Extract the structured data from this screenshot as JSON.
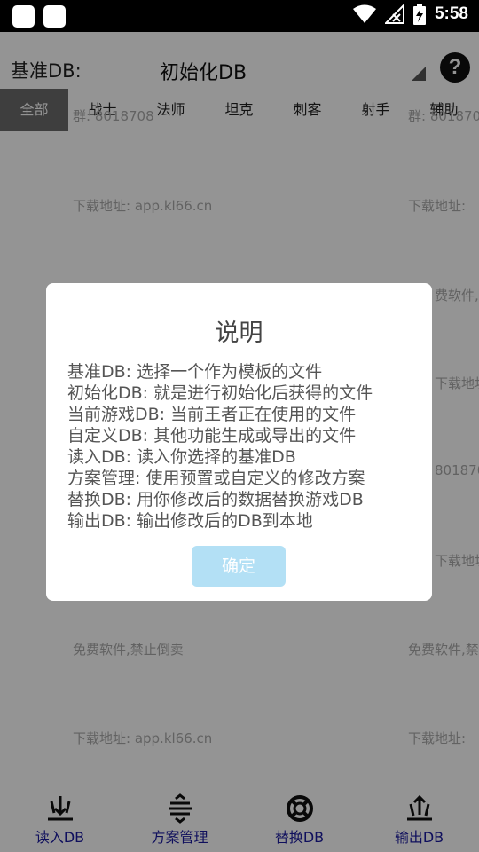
{
  "status_bar": {
    "time": "5:58",
    "icons": [
      "notification-square-icon",
      "notification-square-icon",
      "wifi-icon",
      "signal-off-icon",
      "battery-charging-icon"
    ]
  },
  "header": {
    "db_label": "基准DB:",
    "db_select_value": "初始化DB",
    "help_label": "?"
  },
  "tabs": [
    {
      "label": "全部",
      "active": true
    },
    {
      "label": "战士"
    },
    {
      "label": "法师"
    },
    {
      "label": "坦克"
    },
    {
      "label": "刺客"
    },
    {
      "label": "射手"
    },
    {
      "label": "辅助"
    }
  ],
  "watermarks": {
    "group_1": "群: 8018708",
    "group_2": "群: 801870",
    "group_3": "801870",
    "download_1": "下载地址: app.kl66.cn",
    "download_2": "下载地址:",
    "download_3": "下载地址:",
    "download_4": "下载地址:",
    "download_5": "下载地址: app.kl66.cn",
    "download_6": "下载地址:",
    "free_1": "费软件,禁",
    "free_2": "免费软件,禁止倒卖",
    "free_3": "免费软件,禁"
  },
  "bottom_nav": [
    {
      "label": "读入DB",
      "icon": "import-db-icon"
    },
    {
      "label": "方案管理",
      "icon": "scheme-manage-icon"
    },
    {
      "label": "替换DB",
      "icon": "replace-db-icon"
    },
    {
      "label": "输出DB",
      "icon": "export-db-icon"
    }
  ],
  "dialog": {
    "title": "说明",
    "lines": [
      "基准DB: 选择一个作为模板的文件",
      "初始化DB: 就是进行初始化后获得的文件",
      "当前游戏DB: 当前王者正在使用的文件",
      "自定义DB: 其他功能生成或导出的文件",
      "读入DB: 读入你选择的基准DB",
      "方案管理: 使用预置或自定义的修改方案",
      "替换DB: 用你修改后的数据替换游戏DB",
      "输出DB: 输出修改后的DB到本地"
    ],
    "confirm_label": "确定"
  },
  "colors": {
    "nav_label": "#1a1aa0",
    "active_tab": "#6b6b6b",
    "confirm_button": "#b3e0f5"
  }
}
